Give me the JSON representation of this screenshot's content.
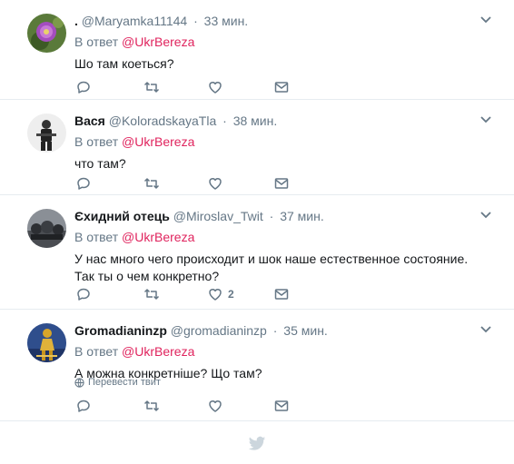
{
  "tweets": [
    {
      "name": ".",
      "handle": "@Maryamka11144",
      "sep": "·",
      "time": "33 мин.",
      "reply_prefix": "В ответ",
      "reply_mention": "@UkrBereza",
      "text": "Шо там коеться?",
      "like_count": "",
      "avatar": "flower"
    },
    {
      "name": "Вася",
      "handle": "@KoloradskayaTla",
      "sep": "·",
      "time": "38 мин.",
      "reply_prefix": "В ответ",
      "reply_mention": "@UkrBereza",
      "text": "что там?",
      "like_count": "",
      "avatar": "soldier"
    },
    {
      "name": "Єхидний отець",
      "handle": "@Miroslav_Twit",
      "sep": "·",
      "time": "37 мин.",
      "reply_prefix": "В ответ",
      "reply_mention": "@UkrBereza",
      "text_lines": [
        "У нас много чего происходит и шок наше естественное состояние.",
        "Так ты о чем конкретно?"
      ],
      "like_count": "2",
      "avatar": "crowd"
    },
    {
      "name": "Gromadianinzp",
      "handle": "@gromadianinzp",
      "sep": "·",
      "time": "35 мин.",
      "reply_prefix": "В ответ",
      "reply_mention": "@UkrBereza",
      "text": "А можна конкретніше? Що там?",
      "translate": "Перевести твит",
      "avatar": "figure"
    }
  ],
  "colors": {
    "accent": "#e0245e",
    "muted": "#657786",
    "divider": "#e6ecf0",
    "bird": "#ccd6dd"
  },
  "icons": [
    "reply-icon",
    "retweet-icon",
    "like-icon",
    "message-icon",
    "chevron-down-icon",
    "globe-icon",
    "twitter-bird-icon"
  ]
}
